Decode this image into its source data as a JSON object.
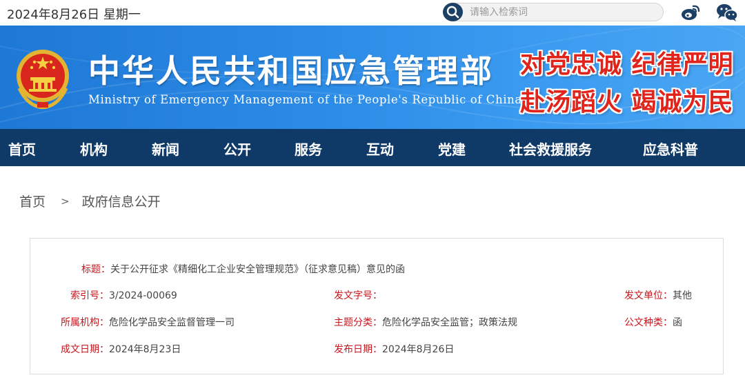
{
  "topbar": {
    "date": "2024年8月26日 星期一",
    "search_placeholder": "请输入检索词",
    "weibo_icon": "weibo-icon",
    "wechat_icon": "wechat-icon"
  },
  "banner": {
    "title_cn": "中华人民共和国应急管理部",
    "title_en": "Ministry of Emergency Management of the People's Republic of China",
    "slogan_line1": "对党忠诚 纪律严明",
    "slogan_line2": "赴汤蹈火 竭诚为民",
    "emblem_icon": "national-emblem-icon"
  },
  "nav": {
    "items": [
      {
        "label": "首页"
      },
      {
        "label": "机构"
      },
      {
        "label": "新闻"
      },
      {
        "label": "公开"
      },
      {
        "label": "服务"
      },
      {
        "label": "互动"
      },
      {
        "label": "党建"
      },
      {
        "label": "社会救援服务"
      },
      {
        "label": "应急科普"
      }
    ]
  },
  "breadcrumb": {
    "home": "首页",
    "separator": ">",
    "current": "政府信息公开"
  },
  "info": {
    "title_label": "标题：",
    "title_value": "关于公开征求《精细化工企业安全管理规范》（征求意见稿）意见的函",
    "index_label": "索引号：",
    "index_value": "3/2024-00069",
    "docno_label": "发文字号：",
    "docno_value": "",
    "issuer_label": "发文单位：",
    "issuer_value": "其他",
    "org_label": "所属机构：",
    "org_value": "危险化学品安全监督管理一司",
    "topic_label": "主题分类：",
    "topic_value": "危险化学品安全监管；政策法规",
    "type_label": "公文种类：",
    "type_value": "函",
    "created_label": "成文日期：",
    "created_value": "2024年8月23日",
    "published_label": "发布日期：",
    "published_value": "2024年8月26日"
  },
  "colors": {
    "banner_blue": "#2d8ce6",
    "nav_navy": "#0f3a68",
    "label_red": "#c8161d",
    "slogan_red": "#e0241b"
  }
}
